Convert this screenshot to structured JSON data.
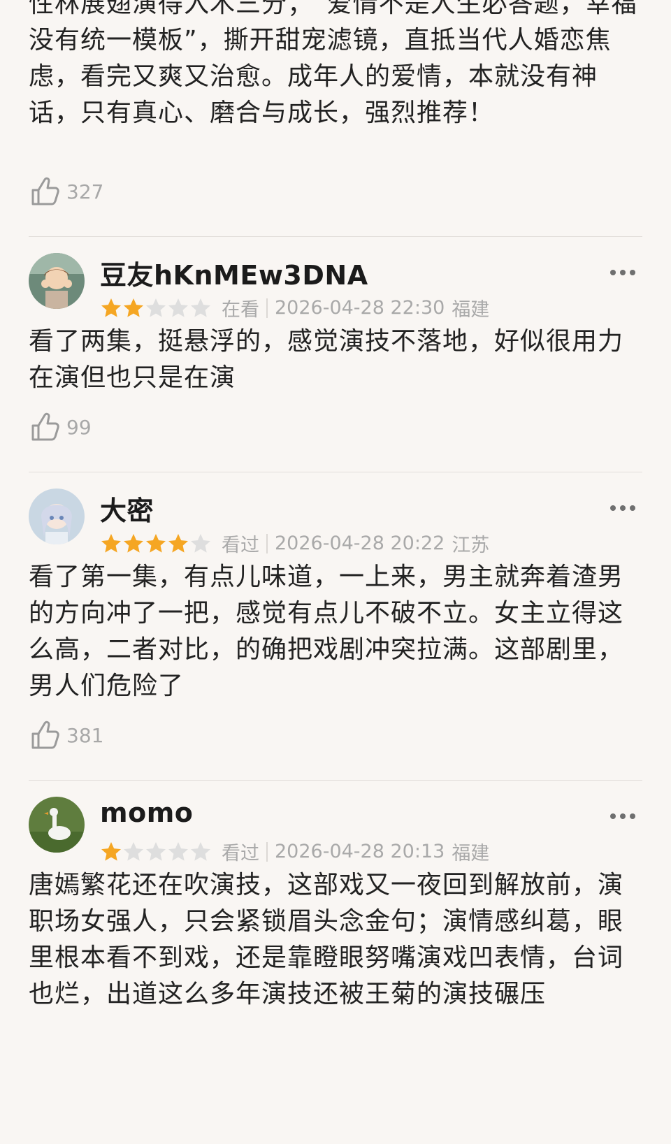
{
  "reviews": [
    {
      "text": "性林展翅演得入木三分；“爱情不是人生必答题，幸福没有统一模板”，撕开甜宠滤镜，直抵当代人婚恋焦虑，看完又爽又治愈。成年人的爱情，本就没有神话，只有真心、磨合与成长，强烈推荐！",
      "likes": "327"
    },
    {
      "user": "豆友hKnMEw3DNA",
      "rating": 2,
      "status": "在看",
      "time": "2026-04-28 22:30",
      "location": "福建",
      "text": "看了两集，挺悬浮的，感觉演技不落地，好似很用力在演但也只是在演",
      "likes": "99"
    },
    {
      "user": "大密",
      "rating": 4,
      "status": "看过",
      "time": "2026-04-28 20:22",
      "location": "江苏",
      "text": "看了第一集，有点儿味道，一上来，男主就奔着渣男的方向冲了一把，感觉有点儿不破不立。女主立得这么高，二者对比，的确把戏剧冲突拉满。这部剧里，男人们危险了",
      "likes": "381"
    },
    {
      "user": "momo",
      "rating": 1,
      "status": "看过",
      "time": "2026-04-28 20:13",
      "location": "福建",
      "text": "唐嫣繁花还在吹演技，这部戏又一夜回到解放前，演职场女强人，只会紧锁眉头念金句；演情感纠葛，眼里根本看不到戏，还是靠瞪眼努嘴演戏凹表情，台词也烂，出道这么多年演技还被王菊的演技碾压"
    }
  ],
  "colors": {
    "star_on": "#f5a623",
    "star_off": "#dedede"
  },
  "icons": {
    "like": "thumbs-up-icon",
    "more": "more-dots-icon"
  }
}
